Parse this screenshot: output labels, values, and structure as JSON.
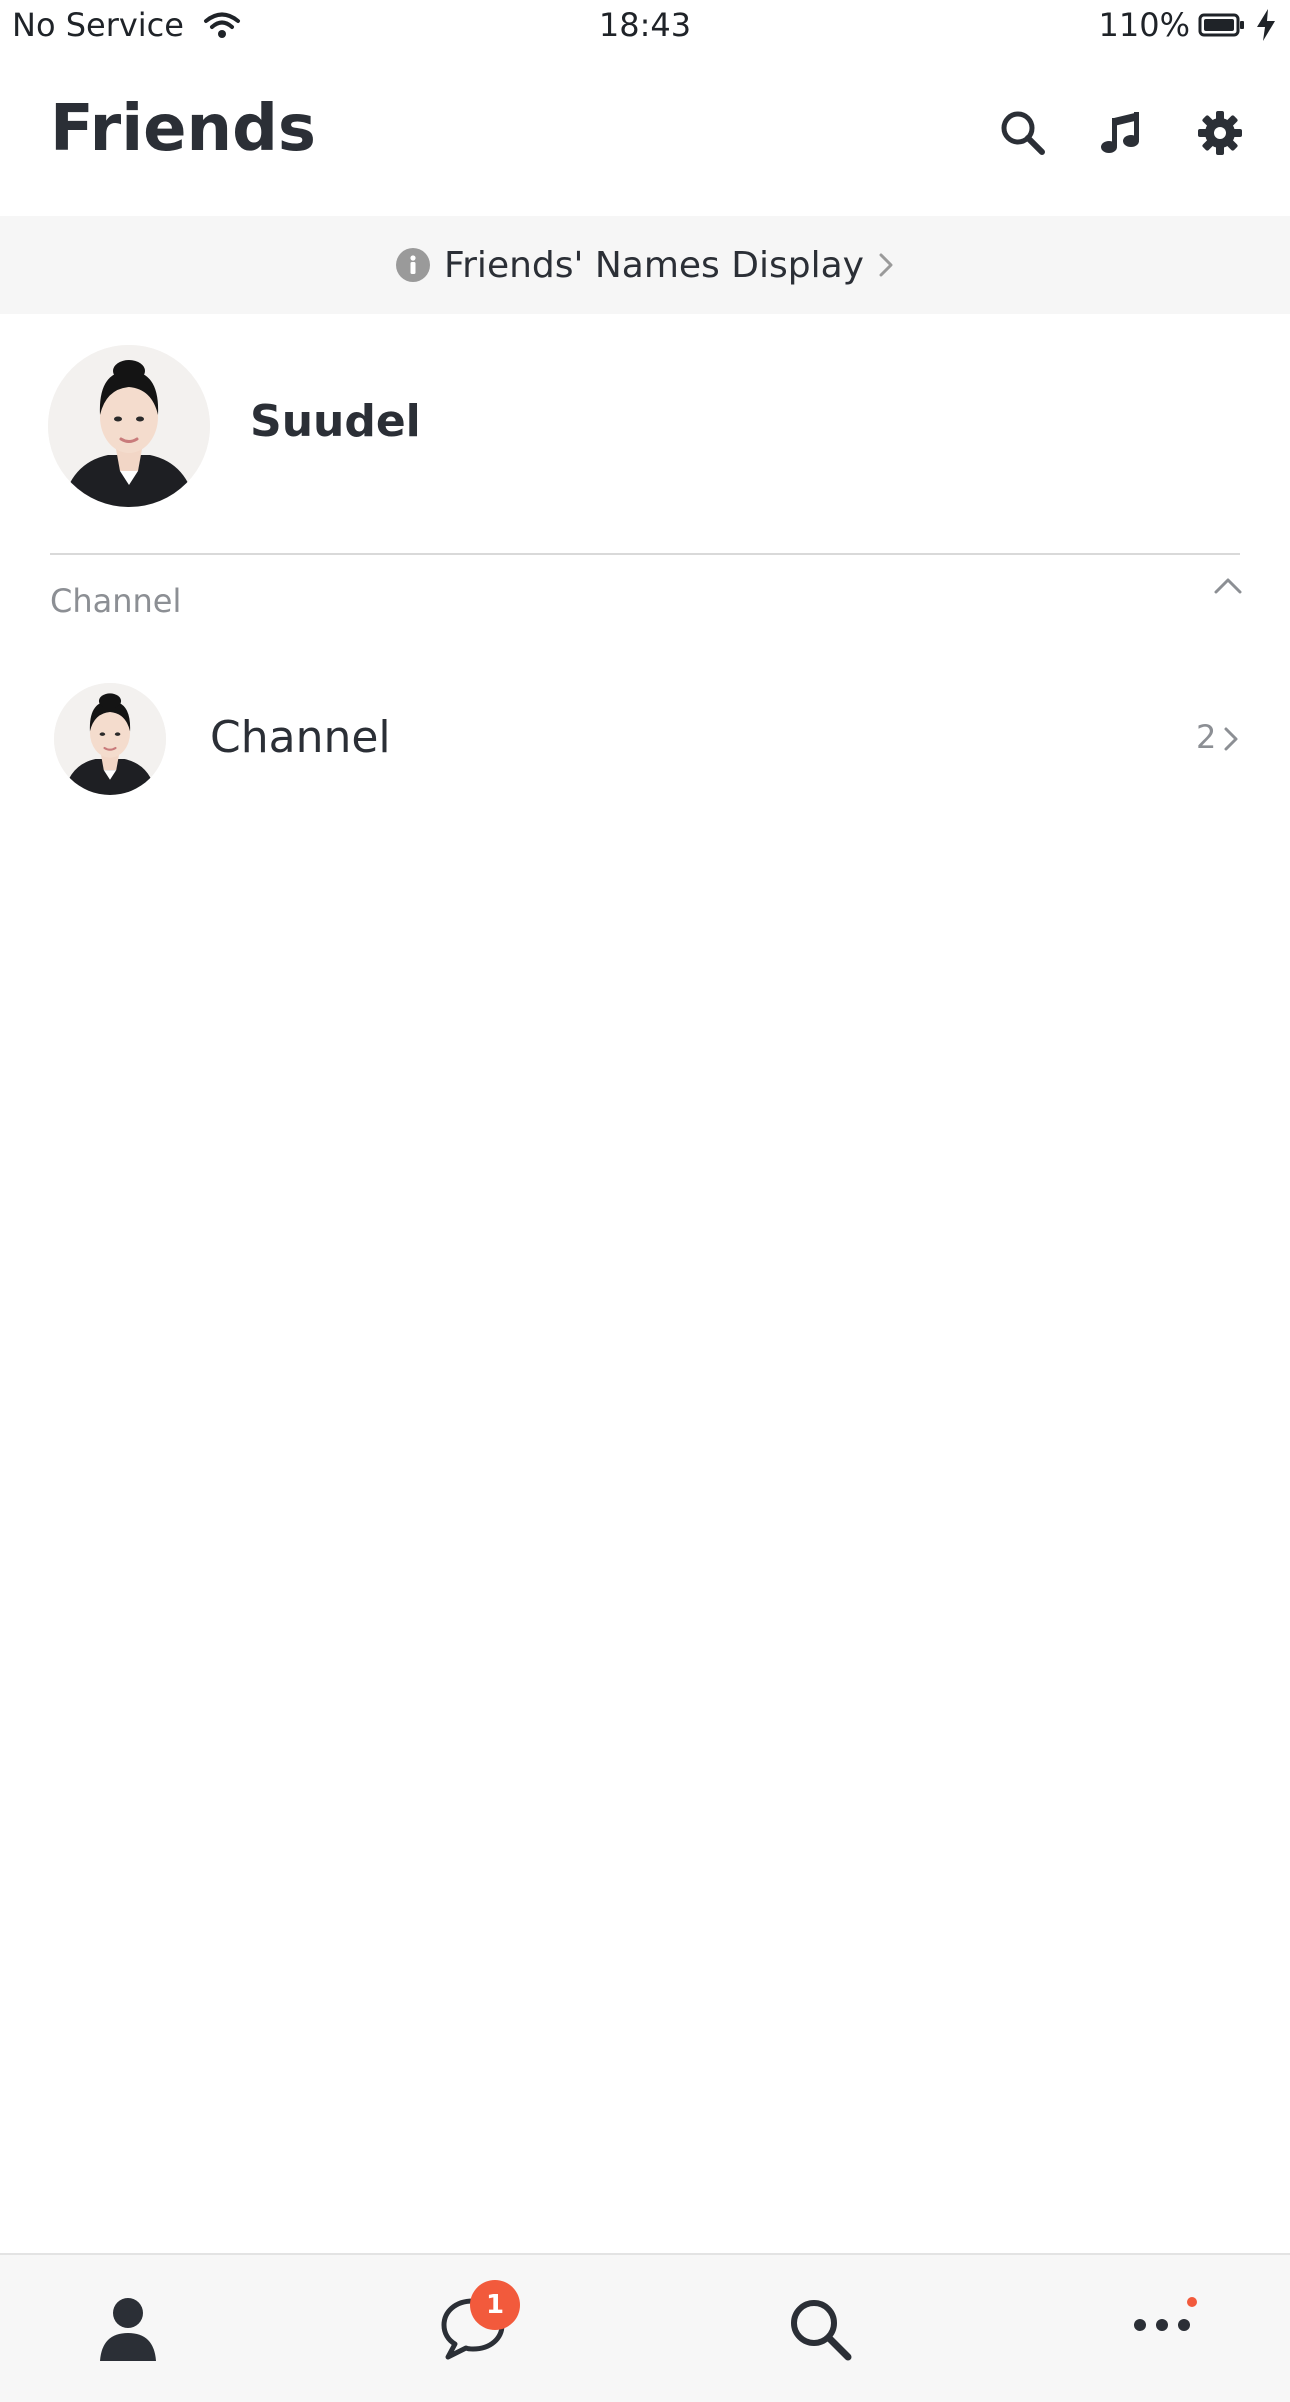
{
  "status_bar": {
    "carrier": "No Service",
    "time": "18:43",
    "battery": "110%"
  },
  "header": {
    "title": "Friends",
    "icons": [
      "search-icon",
      "music-icon",
      "gear-icon"
    ]
  },
  "banner": {
    "text": "Friends' Names Display"
  },
  "profile": {
    "name": "Suudel"
  },
  "channel_section": {
    "label": "Channel",
    "items": [
      {
        "name": "Channel",
        "count": "2"
      }
    ]
  },
  "bottom_nav": {
    "items": [
      "friends-person-icon",
      "chats-bubble-icon",
      "search-icon",
      "more-dots-icon"
    ],
    "chats_badge": "1"
  },
  "colors": {
    "accent": "#f25a3c",
    "text": "#2b2f36",
    "muted": "#8c8f94"
  }
}
